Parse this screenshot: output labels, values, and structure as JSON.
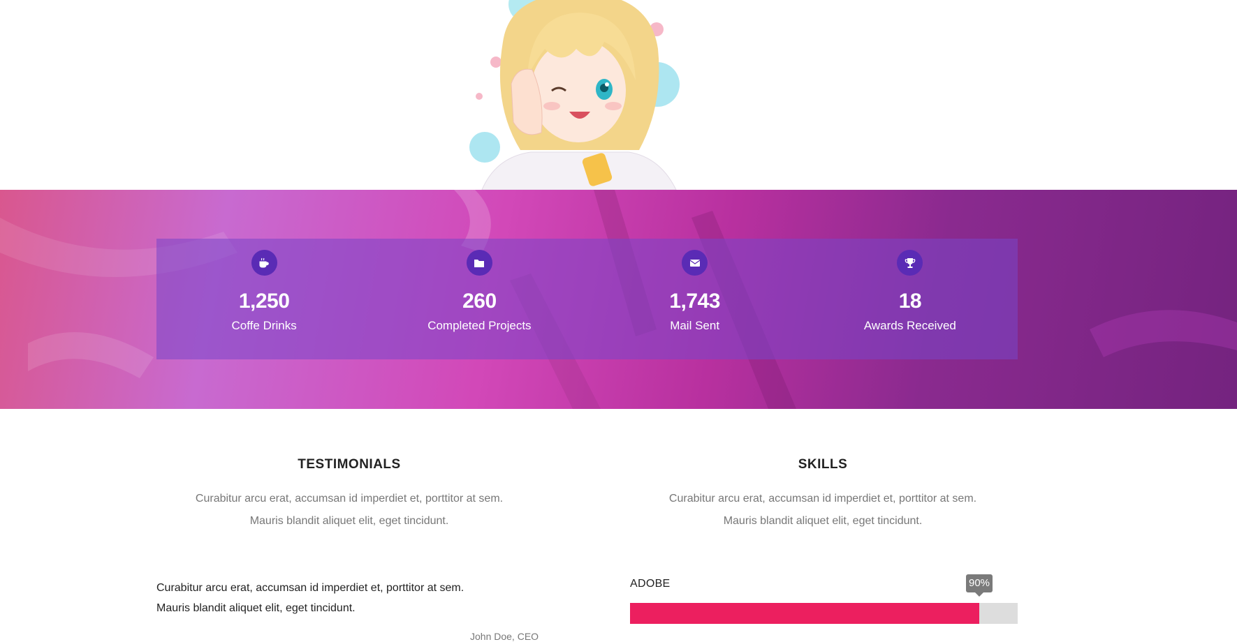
{
  "stats": [
    {
      "icon": "coffee-icon",
      "value": "1,250",
      "label": "Coffe Drinks"
    },
    {
      "icon": "folder-icon",
      "value": "260",
      "label": "Completed Projects"
    },
    {
      "icon": "envelope-icon",
      "value": "1,743",
      "label": "Mail Sent"
    },
    {
      "icon": "trophy-icon",
      "value": "18",
      "label": "Awards Received"
    }
  ],
  "testimonials": {
    "title": "TESTIMONIALS",
    "desc_line1": "Curabitur arcu erat, accumsan id imperdiet et, porttitor at sem.",
    "desc_line2": "Mauris blandit aliquet elit, eget tincidunt.",
    "quote_line1": "Curabitur arcu erat, accumsan id imperdiet et, porttitor at sem.",
    "quote_line2": "Mauris blandit aliquet elit, eget tincidunt.",
    "author": "John Doe, CEO"
  },
  "skills": {
    "title": "SKILLS",
    "desc_line1": "Curabitur arcu erat, accumsan id imperdiet et, porttitor at sem.",
    "desc_line2": "Mauris blandit aliquet elit, eget tincidunt.",
    "items": [
      {
        "name": "ADOBE",
        "percent": 90,
        "percent_label": "90%"
      }
    ]
  },
  "colors": {
    "skill_fill": "#ec1f5f",
    "skill_track": "#dddddd",
    "stat_icon_bg": "#5a2bb5",
    "band_start": "#d9578e",
    "band_end": "#74237f"
  }
}
